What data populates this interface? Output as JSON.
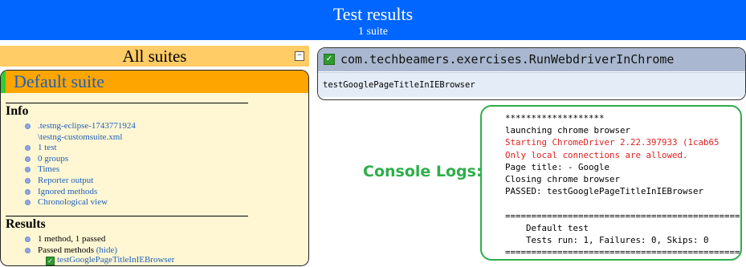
{
  "header": {
    "title": "Test results",
    "subtitle": "1 suite"
  },
  "navigator": {
    "title": "All suites",
    "collapse_icon": "minus-box",
    "suite": {
      "name": "Default suite",
      "status_color": "#33cc33"
    },
    "info": {
      "title": "Info",
      "items": [
        {
          "label": ".testng-eclipse-1743771924\n\\testng-customsuite.xml"
        },
        {
          "label": "1 test"
        },
        {
          "label": "0 groups"
        },
        {
          "label": "Times"
        },
        {
          "label": "Reporter output"
        },
        {
          "label": "Ignored methods"
        },
        {
          "label": "Chronological view"
        }
      ]
    },
    "results": {
      "title": "Results",
      "summary": "1 method, 1 passed",
      "passed_prefix": "Passed methods ",
      "hide_link": "(hide)",
      "method": "testGooglePageTitleInIEBrowser"
    }
  },
  "main": {
    "class_name": "com.techbeamers.exercises.RunWebdriverInChrome",
    "method_name": "testGooglePageTitleInIEBrowser"
  },
  "console": {
    "label": "Console Logs:",
    "lines": [
      {
        "text": "*******************",
        "error": false
      },
      {
        "text": "launching chrome browser",
        "error": false
      },
      {
        "text": "Starting ChromeDriver 2.22.397933 (1cab65",
        "error": true
      },
      {
        "text": "Only local connections are allowed.",
        "error": true
      },
      {
        "text": "Page title: - Google",
        "error": false
      },
      {
        "text": "Closing chrome browser",
        "error": false
      },
      {
        "text": "PASSED: testGooglePageTitleInIEBrowser",
        "error": false
      },
      {
        "text": "",
        "error": false
      },
      {
        "text": "=============================================",
        "error": false
      },
      {
        "text": "    Default test",
        "error": false
      },
      {
        "text": "    Tests run: 1, Failures: 0, Skips: 0",
        "error": false
      },
      {
        "text": "=============================================",
        "error": false
      }
    ]
  },
  "colors": {
    "banner": "#0066ff",
    "suite_bar": "#ffa500",
    "console_accent": "#2eae4a",
    "error_text": "#e02020"
  }
}
